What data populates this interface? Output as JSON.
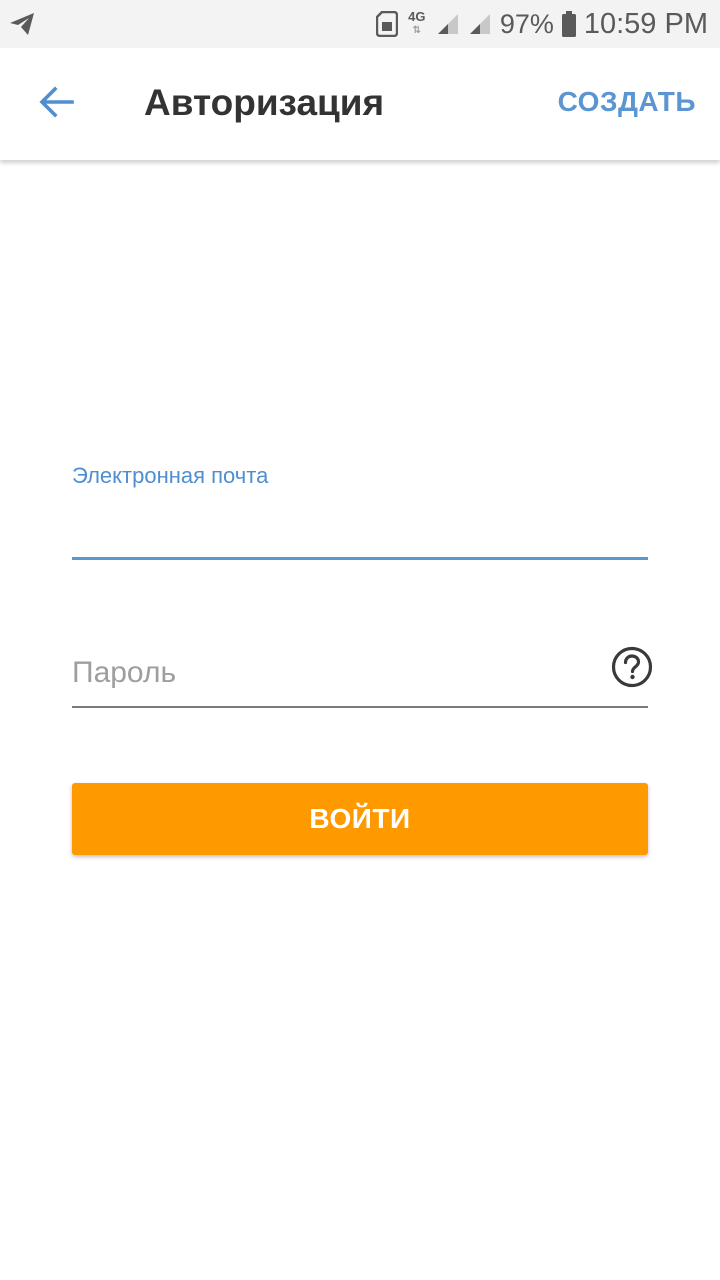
{
  "status_bar": {
    "left_icon": "telegram-send-icon",
    "network_type": "4G",
    "network_arrows": "⇅",
    "battery_percent": "97%",
    "time": "10:59 PM",
    "icons": [
      "sim-card-icon",
      "signal-icon",
      "signal-icon",
      "battery-icon"
    ]
  },
  "app_bar": {
    "back_icon": "arrow-left-icon",
    "title": "Авторизация",
    "create_label": "СОЗДАТЬ"
  },
  "form": {
    "email_label": "Электронная почта",
    "email_value": "",
    "password_placeholder": "Пароль",
    "password_value": "",
    "help_icon": "question-circle-icon",
    "login_label": "ВОЙТИ"
  },
  "colors": {
    "accent": "#5b95d2",
    "login_button": "#ff9900",
    "title_text": "#333333",
    "status_bar_bg": "#f3f3f3"
  }
}
